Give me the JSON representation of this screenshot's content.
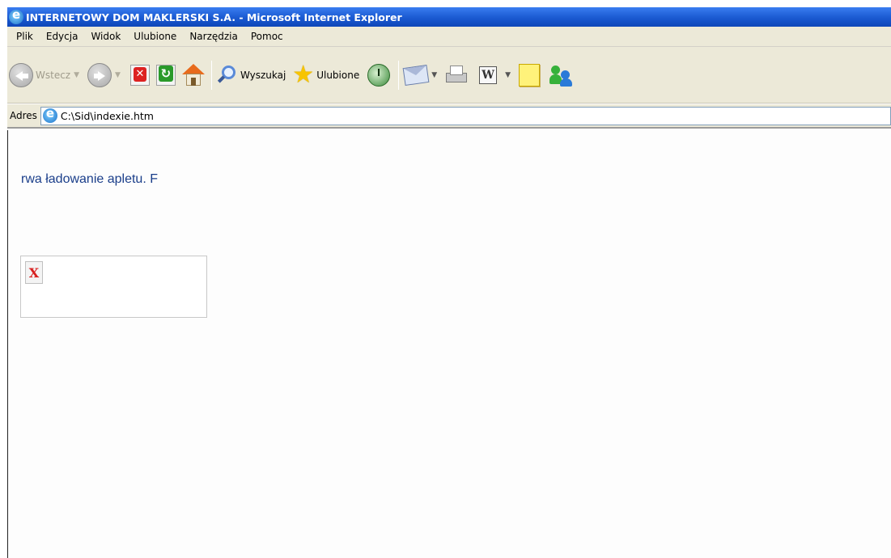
{
  "window": {
    "title": "INTERNETOWY DOM MAKLERSKI S.A. - Microsoft Internet Explorer"
  },
  "menu": {
    "items": [
      "Plik",
      "Edycja",
      "Widok",
      "Ulubione",
      "Narzędzia",
      "Pomoc"
    ]
  },
  "toolbar": {
    "back_label": "Wstecz",
    "search_label": "Wyszukaj",
    "favorites_label": "Ulubione",
    "icons": [
      "back-icon",
      "forward-icon",
      "stop-icon",
      "refresh-icon",
      "home-icon",
      "search-icon",
      "star-icon",
      "history-icon",
      "mail-icon",
      "print-icon",
      "word-icon",
      "note-icon",
      "messenger-icon"
    ]
  },
  "address": {
    "label": "Adres",
    "value": "C:\\Sid\\indexie.htm"
  },
  "content": {
    "status_text": "rwa ładowanie apletu. F"
  },
  "colors": {
    "titlebar": "#1f5fd6",
    "chrome": "#ece9d8",
    "status_text": "#1a3e8a",
    "broken_icon": "#d82020"
  }
}
